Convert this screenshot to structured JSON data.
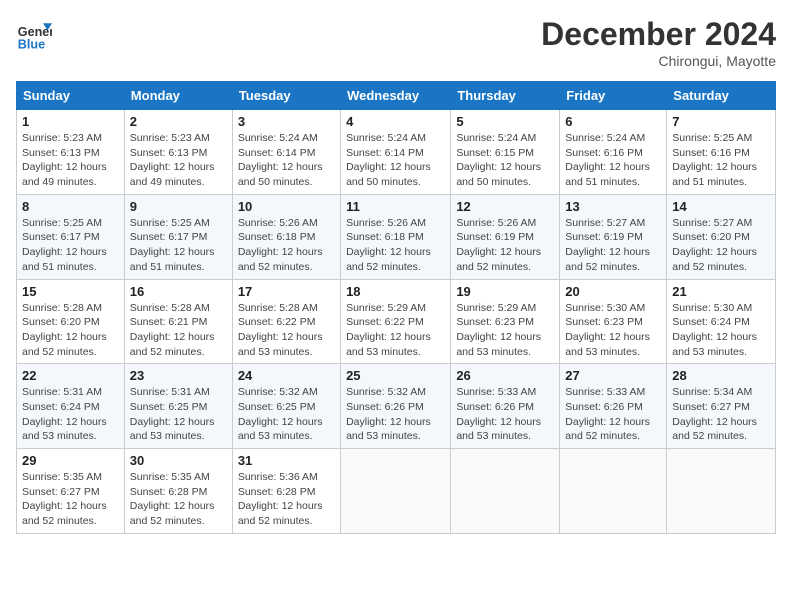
{
  "header": {
    "logo_line1": "General",
    "logo_line2": "Blue",
    "month_year": "December 2024",
    "location": "Chirongui, Mayotte"
  },
  "weekdays": [
    "Sunday",
    "Monday",
    "Tuesday",
    "Wednesday",
    "Thursday",
    "Friday",
    "Saturday"
  ],
  "weeks": [
    [
      {
        "day": "1",
        "info": "Sunrise: 5:23 AM\nSunset: 6:13 PM\nDaylight: 12 hours\nand 49 minutes."
      },
      {
        "day": "2",
        "info": "Sunrise: 5:23 AM\nSunset: 6:13 PM\nDaylight: 12 hours\nand 49 minutes."
      },
      {
        "day": "3",
        "info": "Sunrise: 5:24 AM\nSunset: 6:14 PM\nDaylight: 12 hours\nand 50 minutes."
      },
      {
        "day": "4",
        "info": "Sunrise: 5:24 AM\nSunset: 6:14 PM\nDaylight: 12 hours\nand 50 minutes."
      },
      {
        "day": "5",
        "info": "Sunrise: 5:24 AM\nSunset: 6:15 PM\nDaylight: 12 hours\nand 50 minutes."
      },
      {
        "day": "6",
        "info": "Sunrise: 5:24 AM\nSunset: 6:16 PM\nDaylight: 12 hours\nand 51 minutes."
      },
      {
        "day": "7",
        "info": "Sunrise: 5:25 AM\nSunset: 6:16 PM\nDaylight: 12 hours\nand 51 minutes."
      }
    ],
    [
      {
        "day": "8",
        "info": "Sunrise: 5:25 AM\nSunset: 6:17 PM\nDaylight: 12 hours\nand 51 minutes."
      },
      {
        "day": "9",
        "info": "Sunrise: 5:25 AM\nSunset: 6:17 PM\nDaylight: 12 hours\nand 51 minutes."
      },
      {
        "day": "10",
        "info": "Sunrise: 5:26 AM\nSunset: 6:18 PM\nDaylight: 12 hours\nand 52 minutes."
      },
      {
        "day": "11",
        "info": "Sunrise: 5:26 AM\nSunset: 6:18 PM\nDaylight: 12 hours\nand 52 minutes."
      },
      {
        "day": "12",
        "info": "Sunrise: 5:26 AM\nSunset: 6:19 PM\nDaylight: 12 hours\nand 52 minutes."
      },
      {
        "day": "13",
        "info": "Sunrise: 5:27 AM\nSunset: 6:19 PM\nDaylight: 12 hours\nand 52 minutes."
      },
      {
        "day": "14",
        "info": "Sunrise: 5:27 AM\nSunset: 6:20 PM\nDaylight: 12 hours\nand 52 minutes."
      }
    ],
    [
      {
        "day": "15",
        "info": "Sunrise: 5:28 AM\nSunset: 6:20 PM\nDaylight: 12 hours\nand 52 minutes."
      },
      {
        "day": "16",
        "info": "Sunrise: 5:28 AM\nSunset: 6:21 PM\nDaylight: 12 hours\nand 52 minutes."
      },
      {
        "day": "17",
        "info": "Sunrise: 5:28 AM\nSunset: 6:22 PM\nDaylight: 12 hours\nand 53 minutes."
      },
      {
        "day": "18",
        "info": "Sunrise: 5:29 AM\nSunset: 6:22 PM\nDaylight: 12 hours\nand 53 minutes."
      },
      {
        "day": "19",
        "info": "Sunrise: 5:29 AM\nSunset: 6:23 PM\nDaylight: 12 hours\nand 53 minutes."
      },
      {
        "day": "20",
        "info": "Sunrise: 5:30 AM\nSunset: 6:23 PM\nDaylight: 12 hours\nand 53 minutes."
      },
      {
        "day": "21",
        "info": "Sunrise: 5:30 AM\nSunset: 6:24 PM\nDaylight: 12 hours\nand 53 minutes."
      }
    ],
    [
      {
        "day": "22",
        "info": "Sunrise: 5:31 AM\nSunset: 6:24 PM\nDaylight: 12 hours\nand 53 minutes."
      },
      {
        "day": "23",
        "info": "Sunrise: 5:31 AM\nSunset: 6:25 PM\nDaylight: 12 hours\nand 53 minutes."
      },
      {
        "day": "24",
        "info": "Sunrise: 5:32 AM\nSunset: 6:25 PM\nDaylight: 12 hours\nand 53 minutes."
      },
      {
        "day": "25",
        "info": "Sunrise: 5:32 AM\nSunset: 6:26 PM\nDaylight: 12 hours\nand 53 minutes."
      },
      {
        "day": "26",
        "info": "Sunrise: 5:33 AM\nSunset: 6:26 PM\nDaylight: 12 hours\nand 53 minutes."
      },
      {
        "day": "27",
        "info": "Sunrise: 5:33 AM\nSunset: 6:26 PM\nDaylight: 12 hours\nand 52 minutes."
      },
      {
        "day": "28",
        "info": "Sunrise: 5:34 AM\nSunset: 6:27 PM\nDaylight: 12 hours\nand 52 minutes."
      }
    ],
    [
      {
        "day": "29",
        "info": "Sunrise: 5:35 AM\nSunset: 6:27 PM\nDaylight: 12 hours\nand 52 minutes."
      },
      {
        "day": "30",
        "info": "Sunrise: 5:35 AM\nSunset: 6:28 PM\nDaylight: 12 hours\nand 52 minutes."
      },
      {
        "day": "31",
        "info": "Sunrise: 5:36 AM\nSunset: 6:28 PM\nDaylight: 12 hours\nand 52 minutes."
      },
      {
        "day": "",
        "info": ""
      },
      {
        "day": "",
        "info": ""
      },
      {
        "day": "",
        "info": ""
      },
      {
        "day": "",
        "info": ""
      }
    ]
  ]
}
